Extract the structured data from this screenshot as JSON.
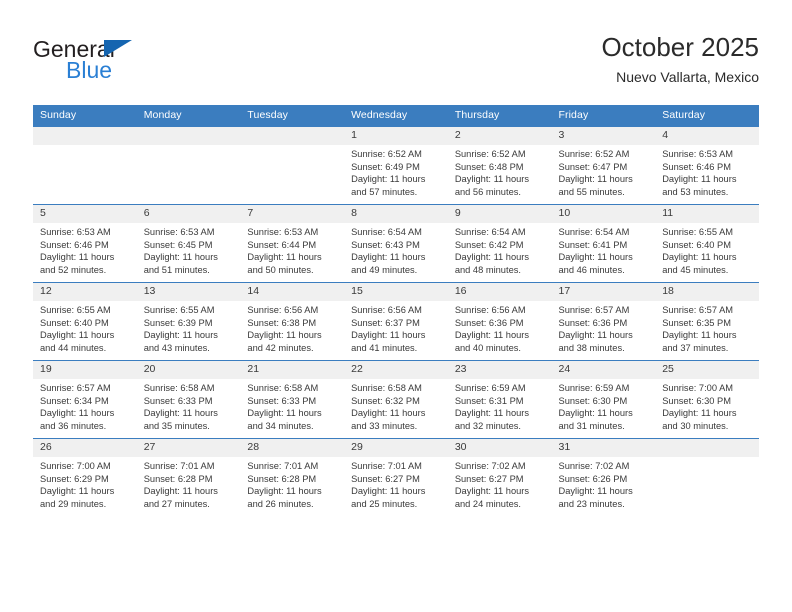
{
  "brand": {
    "name_part1": "General",
    "name_part2": "Blue",
    "primary_color": "#2a7fd4",
    "triangle_color": "#1565b0"
  },
  "header": {
    "title": "October 2025",
    "subtitle": "Nuevo Vallarta, Mexico"
  },
  "calendar": {
    "header_bg": "#3b7dbf",
    "daynum_bg": "#f0f0f0",
    "weekdays": [
      "Sunday",
      "Monday",
      "Tuesday",
      "Wednesday",
      "Thursday",
      "Friday",
      "Saturday"
    ],
    "weeks": [
      [
        {
          "day": "",
          "empty": true
        },
        {
          "day": "",
          "empty": true
        },
        {
          "day": "",
          "empty": true
        },
        {
          "day": "1",
          "sunrise": "Sunrise: 6:52 AM",
          "sunset": "Sunset: 6:49 PM",
          "daylight": "Daylight: 11 hours and 57 minutes."
        },
        {
          "day": "2",
          "sunrise": "Sunrise: 6:52 AM",
          "sunset": "Sunset: 6:48 PM",
          "daylight": "Daylight: 11 hours and 56 minutes."
        },
        {
          "day": "3",
          "sunrise": "Sunrise: 6:52 AM",
          "sunset": "Sunset: 6:47 PM",
          "daylight": "Daylight: 11 hours and 55 minutes."
        },
        {
          "day": "4",
          "sunrise": "Sunrise: 6:53 AM",
          "sunset": "Sunset: 6:46 PM",
          "daylight": "Daylight: 11 hours and 53 minutes."
        }
      ],
      [
        {
          "day": "5",
          "sunrise": "Sunrise: 6:53 AM",
          "sunset": "Sunset: 6:46 PM",
          "daylight": "Daylight: 11 hours and 52 minutes."
        },
        {
          "day": "6",
          "sunrise": "Sunrise: 6:53 AM",
          "sunset": "Sunset: 6:45 PM",
          "daylight": "Daylight: 11 hours and 51 minutes."
        },
        {
          "day": "7",
          "sunrise": "Sunrise: 6:53 AM",
          "sunset": "Sunset: 6:44 PM",
          "daylight": "Daylight: 11 hours and 50 minutes."
        },
        {
          "day": "8",
          "sunrise": "Sunrise: 6:54 AM",
          "sunset": "Sunset: 6:43 PM",
          "daylight": "Daylight: 11 hours and 49 minutes."
        },
        {
          "day": "9",
          "sunrise": "Sunrise: 6:54 AM",
          "sunset": "Sunset: 6:42 PM",
          "daylight": "Daylight: 11 hours and 48 minutes."
        },
        {
          "day": "10",
          "sunrise": "Sunrise: 6:54 AM",
          "sunset": "Sunset: 6:41 PM",
          "daylight": "Daylight: 11 hours and 46 minutes."
        },
        {
          "day": "11",
          "sunrise": "Sunrise: 6:55 AM",
          "sunset": "Sunset: 6:40 PM",
          "daylight": "Daylight: 11 hours and 45 minutes."
        }
      ],
      [
        {
          "day": "12",
          "sunrise": "Sunrise: 6:55 AM",
          "sunset": "Sunset: 6:40 PM",
          "daylight": "Daylight: 11 hours and 44 minutes."
        },
        {
          "day": "13",
          "sunrise": "Sunrise: 6:55 AM",
          "sunset": "Sunset: 6:39 PM",
          "daylight": "Daylight: 11 hours and 43 minutes."
        },
        {
          "day": "14",
          "sunrise": "Sunrise: 6:56 AM",
          "sunset": "Sunset: 6:38 PM",
          "daylight": "Daylight: 11 hours and 42 minutes."
        },
        {
          "day": "15",
          "sunrise": "Sunrise: 6:56 AM",
          "sunset": "Sunset: 6:37 PM",
          "daylight": "Daylight: 11 hours and 41 minutes."
        },
        {
          "day": "16",
          "sunrise": "Sunrise: 6:56 AM",
          "sunset": "Sunset: 6:36 PM",
          "daylight": "Daylight: 11 hours and 40 minutes."
        },
        {
          "day": "17",
          "sunrise": "Sunrise: 6:57 AM",
          "sunset": "Sunset: 6:36 PM",
          "daylight": "Daylight: 11 hours and 38 minutes."
        },
        {
          "day": "18",
          "sunrise": "Sunrise: 6:57 AM",
          "sunset": "Sunset: 6:35 PM",
          "daylight": "Daylight: 11 hours and 37 minutes."
        }
      ],
      [
        {
          "day": "19",
          "sunrise": "Sunrise: 6:57 AM",
          "sunset": "Sunset: 6:34 PM",
          "daylight": "Daylight: 11 hours and 36 minutes."
        },
        {
          "day": "20",
          "sunrise": "Sunrise: 6:58 AM",
          "sunset": "Sunset: 6:33 PM",
          "daylight": "Daylight: 11 hours and 35 minutes."
        },
        {
          "day": "21",
          "sunrise": "Sunrise: 6:58 AM",
          "sunset": "Sunset: 6:33 PM",
          "daylight": "Daylight: 11 hours and 34 minutes."
        },
        {
          "day": "22",
          "sunrise": "Sunrise: 6:58 AM",
          "sunset": "Sunset: 6:32 PM",
          "daylight": "Daylight: 11 hours and 33 minutes."
        },
        {
          "day": "23",
          "sunrise": "Sunrise: 6:59 AM",
          "sunset": "Sunset: 6:31 PM",
          "daylight": "Daylight: 11 hours and 32 minutes."
        },
        {
          "day": "24",
          "sunrise": "Sunrise: 6:59 AM",
          "sunset": "Sunset: 6:30 PM",
          "daylight": "Daylight: 11 hours and 31 minutes."
        },
        {
          "day": "25",
          "sunrise": "Sunrise: 7:00 AM",
          "sunset": "Sunset: 6:30 PM",
          "daylight": "Daylight: 11 hours and 30 minutes."
        }
      ],
      [
        {
          "day": "26",
          "sunrise": "Sunrise: 7:00 AM",
          "sunset": "Sunset: 6:29 PM",
          "daylight": "Daylight: 11 hours and 29 minutes."
        },
        {
          "day": "27",
          "sunrise": "Sunrise: 7:01 AM",
          "sunset": "Sunset: 6:28 PM",
          "daylight": "Daylight: 11 hours and 27 minutes."
        },
        {
          "day": "28",
          "sunrise": "Sunrise: 7:01 AM",
          "sunset": "Sunset: 6:28 PM",
          "daylight": "Daylight: 11 hours and 26 minutes."
        },
        {
          "day": "29",
          "sunrise": "Sunrise: 7:01 AM",
          "sunset": "Sunset: 6:27 PM",
          "daylight": "Daylight: 11 hours and 25 minutes."
        },
        {
          "day": "30",
          "sunrise": "Sunrise: 7:02 AM",
          "sunset": "Sunset: 6:27 PM",
          "daylight": "Daylight: 11 hours and 24 minutes."
        },
        {
          "day": "31",
          "sunrise": "Sunrise: 7:02 AM",
          "sunset": "Sunset: 6:26 PM",
          "daylight": "Daylight: 11 hours and 23 minutes."
        },
        {
          "day": "",
          "empty": true
        }
      ]
    ]
  }
}
